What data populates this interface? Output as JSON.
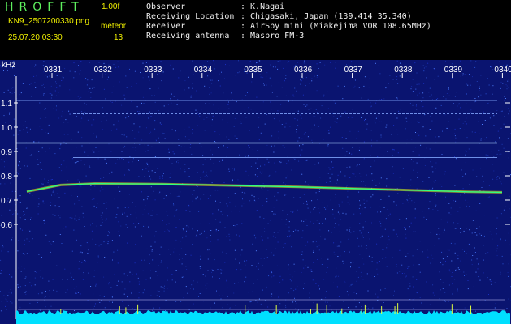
{
  "app": {
    "title": "HROFFT",
    "version": "1.00f",
    "filename": "KN9_2507200330.png",
    "mode_label": "meteor",
    "count": "13",
    "datetime": "25.07.20 03:30"
  },
  "info": [
    {
      "label": "Observer",
      "value": ": K.Nagai"
    },
    {
      "label": "Receiving Location",
      "value": ": Chigasaki, Japan (139.414 35.340)"
    },
    {
      "label": "Receiver",
      "value": ": AirSpy mini (Miakejima VOR 108.65MHz)"
    },
    {
      "label": "Receiving antenna",
      "value": ": Maspro FM-3"
    }
  ],
  "plot": {
    "y_unit": "kHz",
    "time_ticks": [
      "0331",
      "0332",
      "0333",
      "0334",
      "0335",
      "0336",
      "0337",
      "0338",
      "0339",
      "0340"
    ],
    "freq_ticks": [
      "1.1",
      "1.0",
      "0.9",
      "0.8",
      "0.7",
      "0.6"
    ],
    "freq_values": [
      1.1,
      1.0,
      0.9,
      0.8,
      0.7,
      0.6
    ],
    "carrier_lines_khz": [
      1.11,
      1.055,
      0.935,
      0.875
    ],
    "meteor_trail_khz": [
      0.735,
      0.762,
      0.768,
      0.767,
      0.766,
      0.763,
      0.76,
      0.757,
      0.754,
      0.75,
      0.746,
      0.742,
      0.738,
      0.734,
      0.732
    ],
    "background_color": "#0a1470",
    "accent_color": "#00e0ff"
  }
}
